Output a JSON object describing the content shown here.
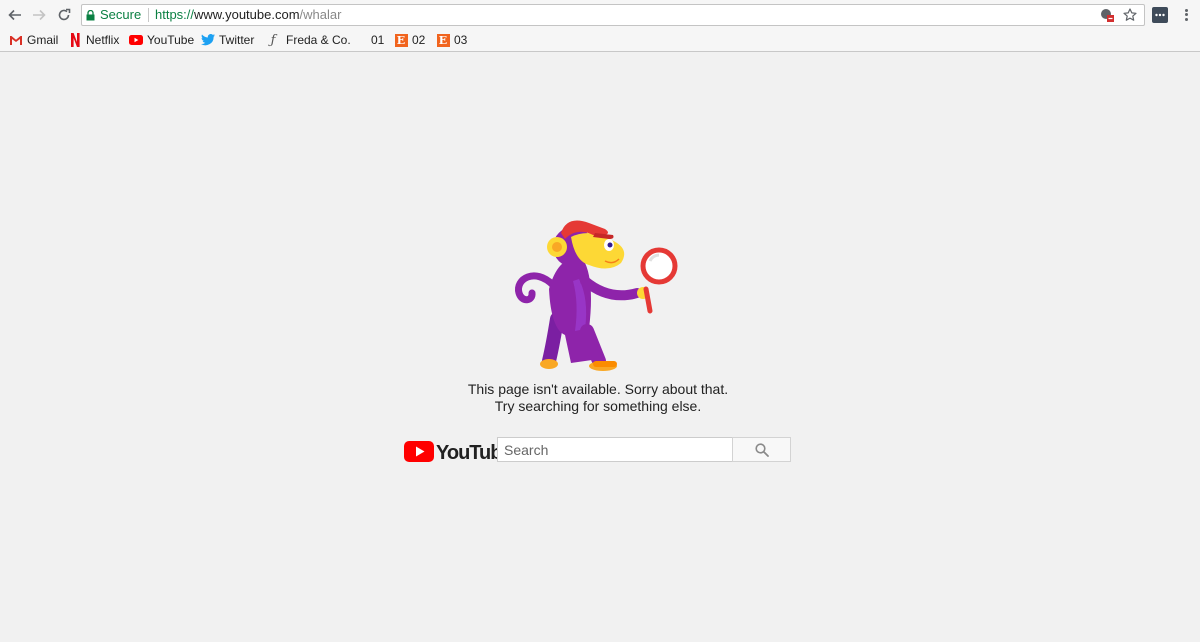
{
  "browser": {
    "secure_label": "Secure",
    "url_scheme": "https://",
    "url_host": "www.youtube.com",
    "url_path": "/whalar"
  },
  "bookmarks": [
    {
      "label": "Gmail",
      "icon": "gmail-icon"
    },
    {
      "label": "Netflix",
      "icon": "netflix-icon"
    },
    {
      "label": "YouTube",
      "icon": "youtube-icon"
    },
    {
      "label": "Twitter",
      "icon": "twitter-icon"
    },
    {
      "label": "Freda & Co.",
      "icon": "freda-icon"
    },
    {
      "label": "01",
      "icon": "blank-icon"
    },
    {
      "label": "02",
      "icon": "etsy-icon"
    },
    {
      "label": "03",
      "icon": "etsy-icon"
    }
  ],
  "error": {
    "line1": "This page isn't available. Sorry about that.",
    "line2": "Try searching for something else."
  },
  "logo": {
    "text": "YouTube"
  },
  "search": {
    "placeholder": "Search",
    "value": ""
  },
  "colors": {
    "youtube_red": "#ff0000",
    "secure_green": "#0b8043",
    "monkey_purple": "#8e24aa",
    "monkey_yellow": "#fdd835"
  }
}
